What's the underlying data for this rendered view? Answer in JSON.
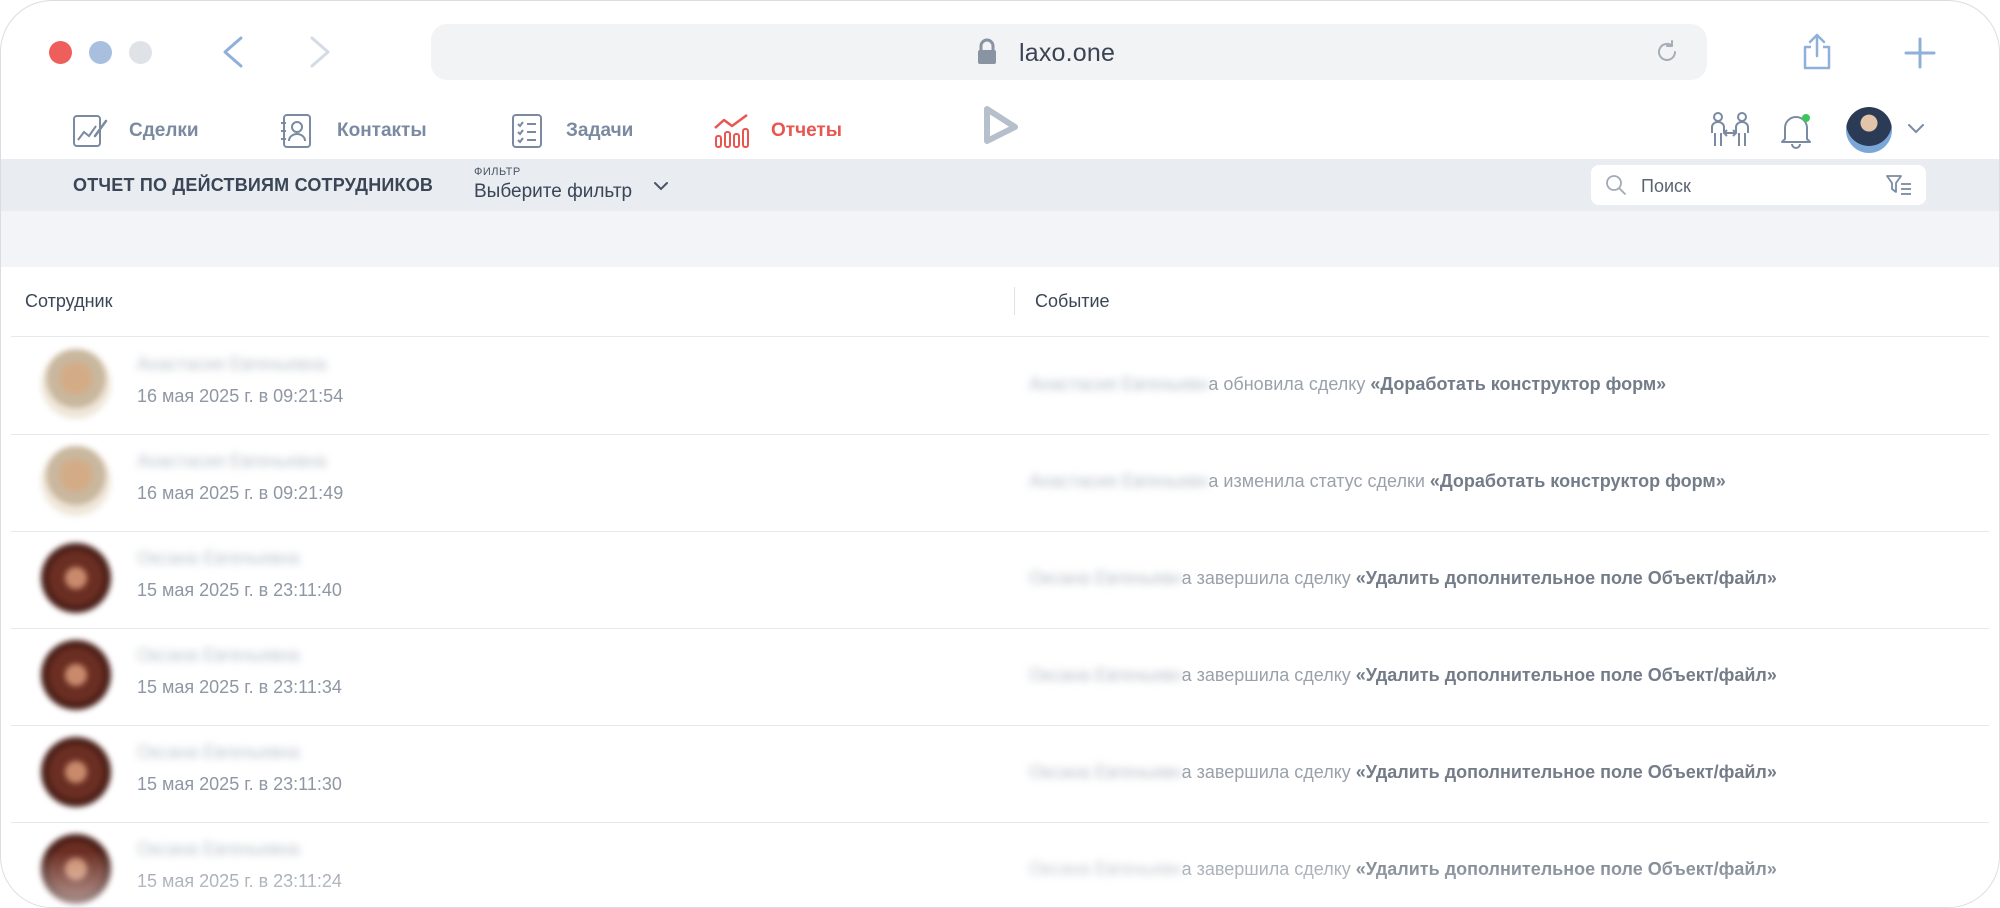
{
  "browser": {
    "url": "laxo.one",
    "icons": [
      "chevron-left-icon",
      "chevron-right-icon",
      "lock-icon",
      "reload-icon",
      "share-icon",
      "plus-icon"
    ]
  },
  "nav": {
    "items": [
      {
        "label": "Сделки",
        "icon": "deals-icon",
        "active": false
      },
      {
        "label": "Контакты",
        "icon": "contacts-icon",
        "active": false
      },
      {
        "label": "Задачи",
        "icon": "tasks-icon",
        "active": false
      },
      {
        "label": "Отчеты",
        "icon": "reports-icon",
        "active": true
      }
    ],
    "accent_color": "#e8564f",
    "muted_color": "#7a8aa0"
  },
  "subheader": {
    "title": "ОТЧЕТ ПО ДЕЙСТВИЯМ СОТРУДНИКОВ",
    "filter_caption": "ФИЛЬТР",
    "filter_value": "Выберите фильтр",
    "search_placeholder": "Поиск"
  },
  "table": {
    "columns": [
      "Сотрудник",
      "Событие"
    ],
    "rows": [
      {
        "name": "Анастасия Евгеньевна",
        "time": "16 мая 2025 г. в 09:21:54",
        "actor": "Анастасия Евгеньевн",
        "action": "а обновила сделку ",
        "deal": "«Доработать конструктор форм»",
        "avatar": "man"
      },
      {
        "name": "Анастасия Евгеньевна",
        "time": "16 мая 2025 г. в 09:21:49",
        "actor": "Анастасия Евгеньевн",
        "action": "а изменила статус сделки ",
        "deal": "«Доработать конструктор форм»",
        "avatar": "man"
      },
      {
        "name": "Оксана Евгеньевна",
        "time": "15 мая 2025 г. в 23:11:40",
        "actor": "Оксана Евгеньевн",
        "action": "а завершила сделку ",
        "deal": "«Удалить дополнительное поле Объект/файл»",
        "avatar": "woman"
      },
      {
        "name": "Оксана Евгеньевна",
        "time": "15 мая 2025 г. в 23:11:34",
        "actor": "Оксана Евгеньевн",
        "action": "а завершила сделку ",
        "deal": "«Удалить дополнительное поле Объект/файл»",
        "avatar": "woman"
      },
      {
        "name": "Оксана Евгеньевна",
        "time": "15 мая 2025 г. в 23:11:30",
        "actor": "Оксана Евгеньевн",
        "action": "а завершила сделку ",
        "deal": "«Удалить дополнительное поле Объект/файл»",
        "avatar": "woman"
      },
      {
        "name": "Оксана Евгеньевна",
        "time": "15 мая 2025 г. в 23:11:24",
        "actor": "Оксана Евгеньевн",
        "action": "а завершила сделку ",
        "deal": "«Удалить дополнительное поле Объект/файл»",
        "avatar": "woman"
      }
    ]
  }
}
